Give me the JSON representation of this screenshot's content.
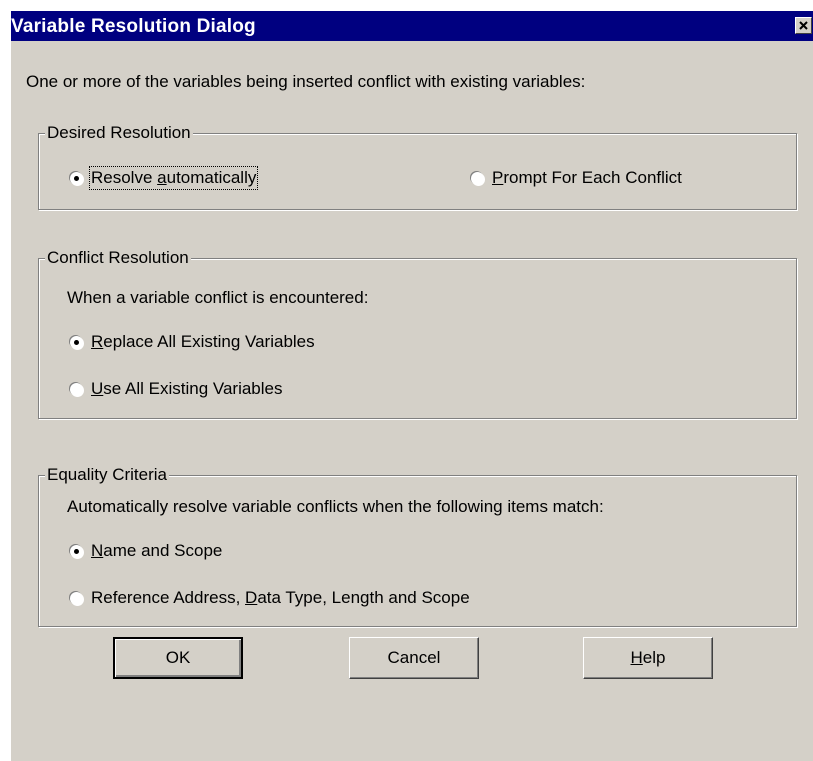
{
  "window": {
    "title": "Variable Resolution Dialog"
  },
  "intro_text": "One or more of the variables being inserted conflict with existing variables:",
  "desired_resolution": {
    "legend": "Desired Resolution",
    "options": [
      {
        "pre": "Resolve ",
        "key": "a",
        "post": "utomatically",
        "selected": true
      },
      {
        "pre": "",
        "key": "P",
        "post": "rompt For Each Conflict",
        "selected": false
      }
    ]
  },
  "conflict_resolution": {
    "legend": "Conflict Resolution",
    "prompt": "When a variable conflict is encountered:",
    "options": [
      {
        "pre": "",
        "key": "R",
        "post": "eplace All Existing Variables",
        "selected": true
      },
      {
        "pre": "",
        "key": "U",
        "post": "se All Existing Variables",
        "selected": false
      }
    ]
  },
  "equality_criteria": {
    "legend": "Equality Criteria",
    "prompt": "Automatically resolve variable conflicts when the following items match:",
    "options": [
      {
        "pre": "",
        "key": "N",
        "post": "ame and Scope",
        "selected": true
      },
      {
        "pre": "Reference Address, ",
        "key": "D",
        "post": "ata Type, Length and Scope",
        "selected": false
      }
    ]
  },
  "buttons": {
    "ok": "OK",
    "cancel": "Cancel",
    "help_key": "H",
    "help_rest": "elp"
  },
  "icons": {
    "close": "close-icon"
  }
}
